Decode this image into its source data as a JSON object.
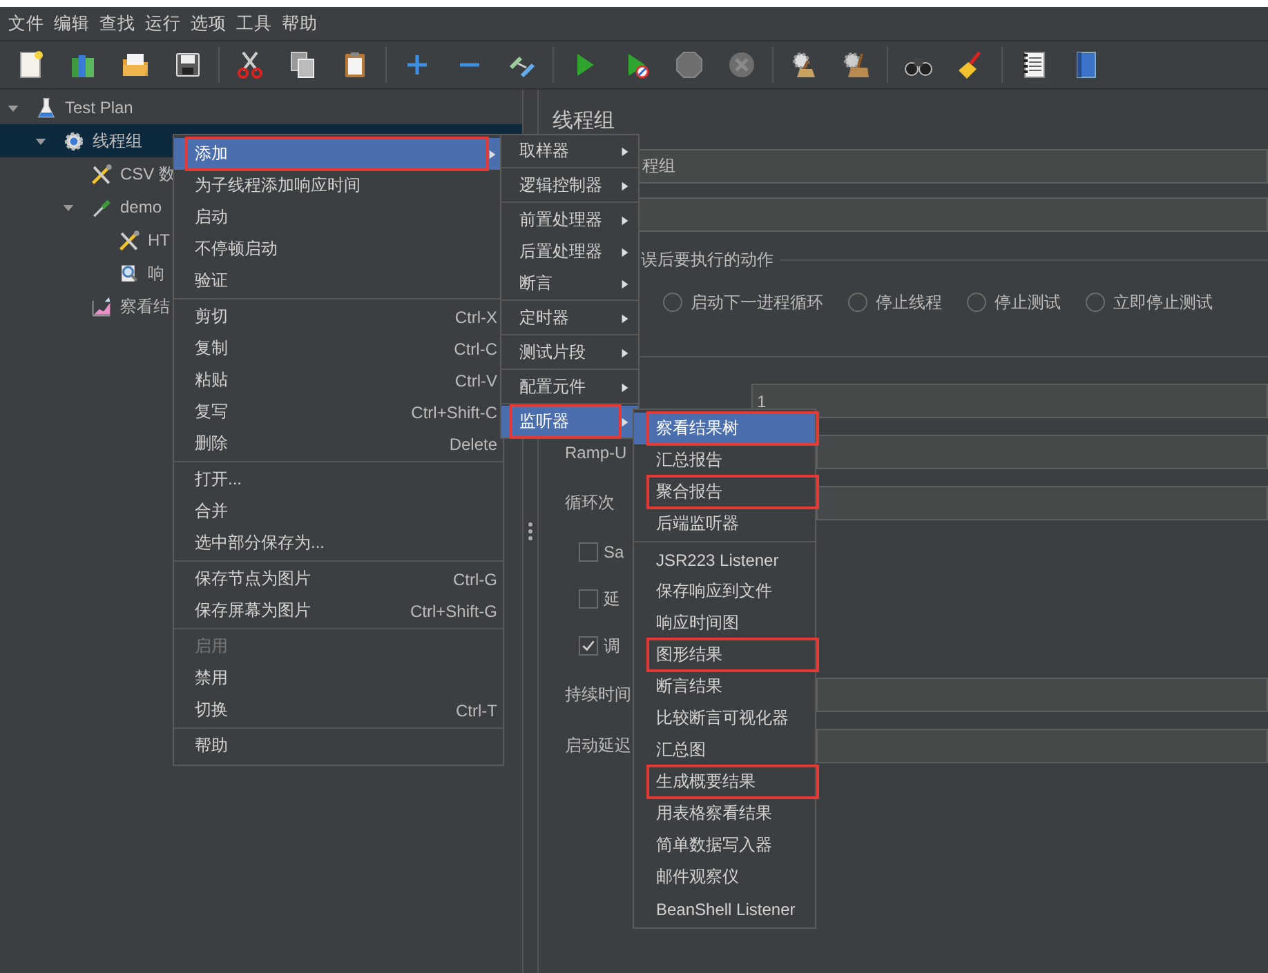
{
  "menubar": [
    "文件",
    "编辑",
    "查找",
    "运行",
    "选项",
    "工具",
    "帮助"
  ],
  "tree": [
    {
      "label": "Test Plan",
      "kind": "plan",
      "expanded": true,
      "selected": false,
      "children": [
        {
          "label": "线程组",
          "kind": "thread-group",
          "expanded": true,
          "selected": true,
          "children": [
            {
              "label": "CSV 数",
              "kind": "config",
              "selected": false
            },
            {
              "label": "demo",
              "kind": "sampler",
              "expanded": true,
              "selected": false,
              "children": [
                {
                  "label": "HT",
                  "kind": "config",
                  "selected": false
                },
                {
                  "label": "响",
                  "kind": "assertion",
                  "selected": false
                }
              ]
            },
            {
              "label": "察看结",
              "kind": "listener",
              "selected": false
            }
          ]
        }
      ]
    }
  ],
  "panel": {
    "title": "线程组",
    "name_value": "程组",
    "legend": "误后要执行的动作",
    "radios": [
      {
        "label": "启动下一进程循环",
        "selected": false
      },
      {
        "label": "停止线程",
        "selected": false
      },
      {
        "label": "停止测试",
        "selected": false
      },
      {
        "label": "立即停止测试",
        "selected": false
      }
    ],
    "rows": [
      {
        "kind": "field",
        "value": "1"
      },
      {
        "kind": "field",
        "label": "Ramp-U"
      },
      {
        "kind": "field",
        "label": "循环次"
      },
      {
        "kind": "check",
        "label": "Sa",
        "checked": false
      },
      {
        "kind": "check",
        "label": "延",
        "checked": false
      },
      {
        "kind": "check",
        "label": "调",
        "checked": true
      },
      {
        "kind": "field",
        "label": "持续时间"
      },
      {
        "kind": "field",
        "label": "启动延迟"
      }
    ]
  },
  "context_menu": {
    "items": [
      {
        "kind": "item",
        "label": "添加",
        "submenu": true,
        "selected": true,
        "disabled": false,
        "annotated": true
      },
      {
        "kind": "item",
        "label": "为子线程添加响应时间",
        "submenu": false,
        "selected": false,
        "disabled": false,
        "annotated": false
      },
      {
        "kind": "item",
        "label": "启动",
        "submenu": false,
        "selected": false,
        "disabled": false,
        "annotated": false
      },
      {
        "kind": "item",
        "label": "不停顿启动",
        "submenu": false,
        "selected": false,
        "disabled": false,
        "annotated": false
      },
      {
        "kind": "item",
        "label": "验证",
        "submenu": false,
        "selected": false,
        "disabled": false,
        "annotated": false
      },
      {
        "kind": "separator"
      },
      {
        "kind": "item",
        "label": "剪切",
        "shortcut": "Ctrl-X",
        "submenu": false,
        "selected": false,
        "disabled": false,
        "annotated": false
      },
      {
        "kind": "item",
        "label": "复制",
        "shortcut": "Ctrl-C",
        "submenu": false,
        "selected": false,
        "disabled": false,
        "annotated": false
      },
      {
        "kind": "item",
        "label": "粘贴",
        "shortcut": "Ctrl-V",
        "submenu": false,
        "selected": false,
        "disabled": false,
        "annotated": false
      },
      {
        "kind": "item",
        "label": "复写",
        "shortcut": "Ctrl+Shift-C",
        "submenu": false,
        "selected": false,
        "disabled": false,
        "annotated": false
      },
      {
        "kind": "item",
        "label": "删除",
        "shortcut": "Delete",
        "submenu": false,
        "selected": false,
        "disabled": false,
        "annotated": false
      },
      {
        "kind": "separator"
      },
      {
        "kind": "item",
        "label": "打开...",
        "submenu": false,
        "selected": false,
        "disabled": false,
        "annotated": false
      },
      {
        "kind": "item",
        "label": "合并",
        "submenu": false,
        "selected": false,
        "disabled": false,
        "annotated": false
      },
      {
        "kind": "item",
        "label": "选中部分保存为...",
        "submenu": false,
        "selected": false,
        "disabled": false,
        "annotated": false
      },
      {
        "kind": "separator"
      },
      {
        "kind": "item",
        "label": "保存节点为图片",
        "shortcut": "Ctrl-G",
        "submenu": false,
        "selected": false,
        "disabled": false,
        "annotated": false
      },
      {
        "kind": "item",
        "label": "保存屏幕为图片",
        "shortcut": "Ctrl+Shift-G",
        "submenu": false,
        "selected": false,
        "disabled": false,
        "annotated": false
      },
      {
        "kind": "separator"
      },
      {
        "kind": "item",
        "label": "启用",
        "submenu": false,
        "selected": false,
        "disabled": true,
        "annotated": false
      },
      {
        "kind": "item",
        "label": "禁用",
        "submenu": false,
        "selected": false,
        "disabled": false,
        "annotated": false
      },
      {
        "kind": "item",
        "label": "切换",
        "shortcut": "Ctrl-T",
        "submenu": false,
        "selected": false,
        "disabled": false,
        "annotated": false
      },
      {
        "kind": "separator"
      },
      {
        "kind": "item",
        "label": "帮助",
        "submenu": false,
        "selected": false,
        "disabled": false,
        "annotated": false
      }
    ]
  },
  "add_menu": {
    "items": [
      {
        "kind": "item",
        "label": "取样器",
        "submenu": true,
        "selected": false,
        "disabled": false,
        "annotated": false
      },
      {
        "kind": "separator"
      },
      {
        "kind": "item",
        "label": "逻辑控制器",
        "submenu": true,
        "selected": false,
        "disabled": false,
        "annotated": false
      },
      {
        "kind": "separator"
      },
      {
        "kind": "item",
        "label": "前置处理器",
        "submenu": true,
        "selected": false,
        "disabled": false,
        "annotated": false
      },
      {
        "kind": "item",
        "label": "后置处理器",
        "submenu": true,
        "selected": false,
        "disabled": false,
        "annotated": false
      },
      {
        "kind": "item",
        "label": "断言",
        "submenu": true,
        "selected": false,
        "disabled": false,
        "annotated": false
      },
      {
        "kind": "separator"
      },
      {
        "kind": "item",
        "label": "定时器",
        "submenu": true,
        "selected": false,
        "disabled": false,
        "annotated": false
      },
      {
        "kind": "separator"
      },
      {
        "kind": "item",
        "label": "测试片段",
        "submenu": true,
        "selected": false,
        "disabled": false,
        "annotated": false
      },
      {
        "kind": "separator"
      },
      {
        "kind": "item",
        "label": "配置元件",
        "submenu": true,
        "selected": false,
        "disabled": false,
        "annotated": false
      },
      {
        "kind": "separator"
      },
      {
        "kind": "item",
        "label": "监听器",
        "submenu": true,
        "selected": true,
        "disabled": false,
        "annotated": true
      }
    ]
  },
  "listener_menu": {
    "items": [
      {
        "kind": "item",
        "label": "察看结果树",
        "selected": true,
        "disabled": false,
        "annotated": true
      },
      {
        "kind": "item",
        "label": "汇总报告",
        "selected": false,
        "disabled": false,
        "annotated": false
      },
      {
        "kind": "item",
        "label": "聚合报告",
        "selected": false,
        "disabled": false,
        "annotated": true
      },
      {
        "kind": "item",
        "label": "后端监听器",
        "selected": false,
        "disabled": false,
        "annotated": false
      },
      {
        "kind": "separator"
      },
      {
        "kind": "item",
        "label": "JSR223 Listener",
        "selected": false,
        "disabled": false,
        "annotated": false
      },
      {
        "kind": "item",
        "label": "保存响应到文件",
        "selected": false,
        "disabled": false,
        "annotated": false
      },
      {
        "kind": "item",
        "label": "响应时间图",
        "selected": false,
        "disabled": false,
        "annotated": false
      },
      {
        "kind": "item",
        "label": "图形结果",
        "selected": false,
        "disabled": false,
        "annotated": true
      },
      {
        "kind": "item",
        "label": "断言结果",
        "selected": false,
        "disabled": false,
        "annotated": false
      },
      {
        "kind": "item",
        "label": "比较断言可视化器",
        "selected": false,
        "disabled": false,
        "annotated": false
      },
      {
        "kind": "item",
        "label": "汇总图",
        "selected": false,
        "disabled": false,
        "annotated": false
      },
      {
        "kind": "item",
        "label": "生成概要结果",
        "selected": false,
        "disabled": false,
        "annotated": true
      },
      {
        "kind": "item",
        "label": "用表格察看结果",
        "selected": false,
        "disabled": false,
        "annotated": false
      },
      {
        "kind": "item",
        "label": "简单数据写入器",
        "selected": false,
        "disabled": false,
        "annotated": false
      },
      {
        "kind": "item",
        "label": "邮件观察仪",
        "selected": false,
        "disabled": false,
        "annotated": false
      },
      {
        "kind": "item",
        "label": "BeanShell Listener",
        "selected": false,
        "disabled": false,
        "annotated": false
      }
    ]
  }
}
